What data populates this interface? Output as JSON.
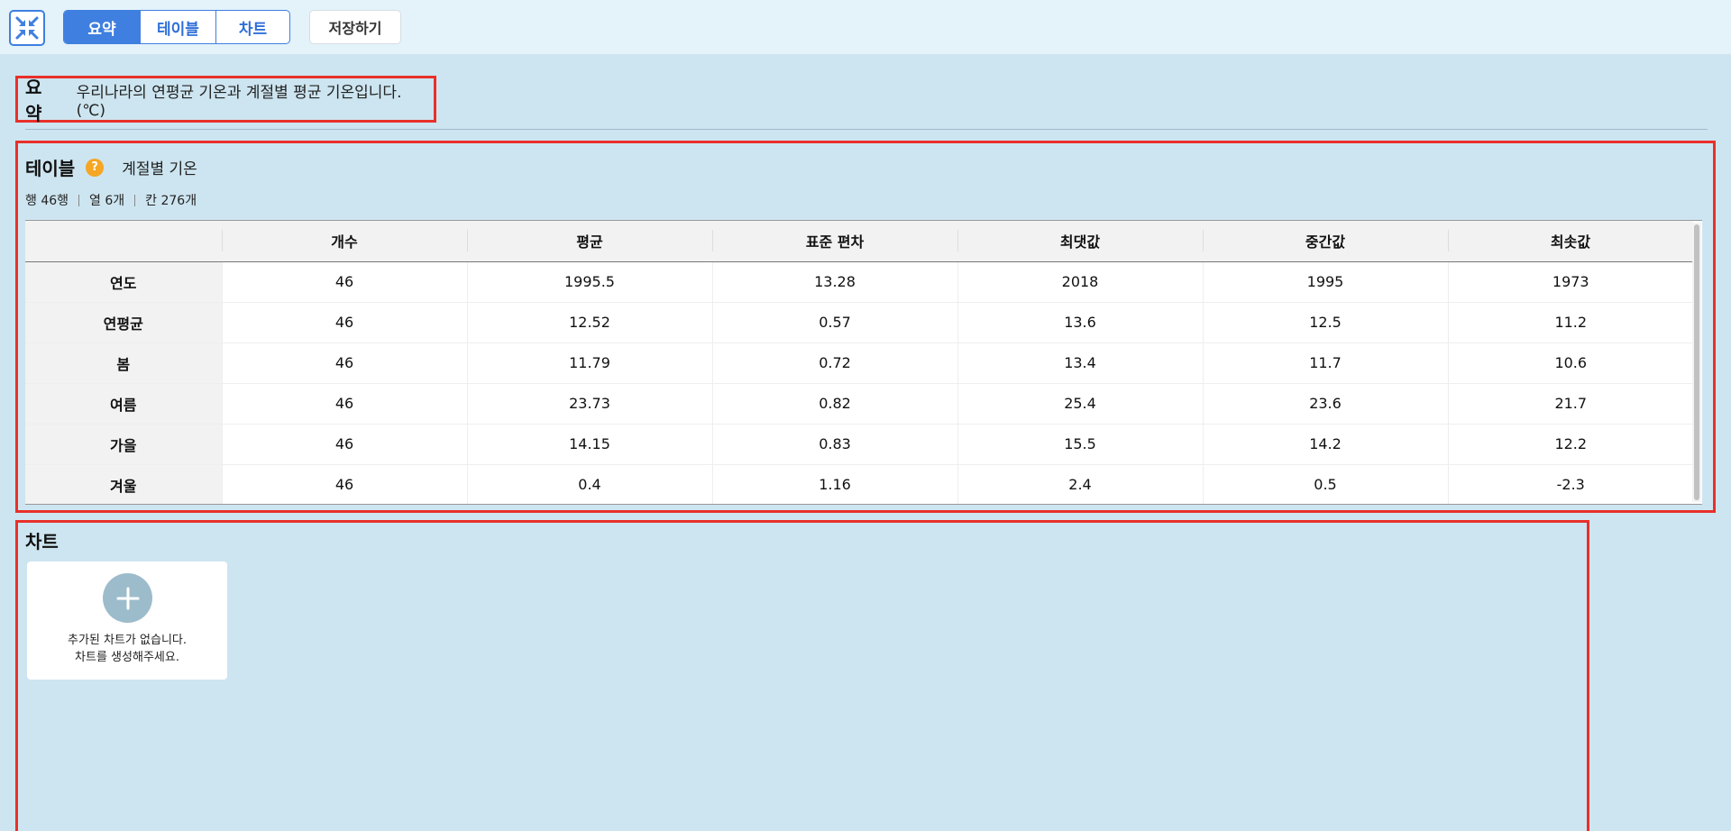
{
  "toolbar": {
    "collapse_icon": "collapse-arrows-icon",
    "tabs": [
      {
        "label": "요약",
        "active": true
      },
      {
        "label": "테이블",
        "active": false
      },
      {
        "label": "차트",
        "active": false
      }
    ],
    "save_label": "저장하기",
    "accent_color": "#3f7fe0"
  },
  "summary": {
    "title": "요약",
    "text": "우리나라의 연평균 기온과 계절별 평균 기온입니다. (℃)"
  },
  "table_section": {
    "title": "테이블",
    "help_icon": "?",
    "subtitle": "계절별 기온",
    "stats": {
      "rows": "행 46행",
      "cols": "열 6개",
      "cells": "칸 276개"
    },
    "columns": [
      "",
      "개수",
      "평균",
      "표준 편차",
      "최댓값",
      "중간값",
      "최솟값"
    ],
    "rows": [
      {
        "label": "연도",
        "cells": [
          "46",
          "1995.5",
          "13.28",
          "2018",
          "1995",
          "1973"
        ]
      },
      {
        "label": "연평균",
        "cells": [
          "46",
          "12.52",
          "0.57",
          "13.6",
          "12.5",
          "11.2"
        ]
      },
      {
        "label": "봄",
        "cells": [
          "46",
          "11.79",
          "0.72",
          "13.4",
          "11.7",
          "10.6"
        ]
      },
      {
        "label": "여름",
        "cells": [
          "46",
          "23.73",
          "0.82",
          "25.4",
          "23.6",
          "21.7"
        ]
      },
      {
        "label": "가을",
        "cells": [
          "46",
          "14.15",
          "0.83",
          "15.5",
          "14.2",
          "12.2"
        ]
      },
      {
        "label": "겨울",
        "cells": [
          "46",
          "0.4",
          "1.16",
          "2.4",
          "0.5",
          "-2.3"
        ]
      }
    ]
  },
  "chart_section": {
    "title": "차트",
    "empty_line1": "추가된 차트가 없습니다.",
    "empty_line2": "차트를 생성해주세요.",
    "add_icon": "plus-icon"
  }
}
